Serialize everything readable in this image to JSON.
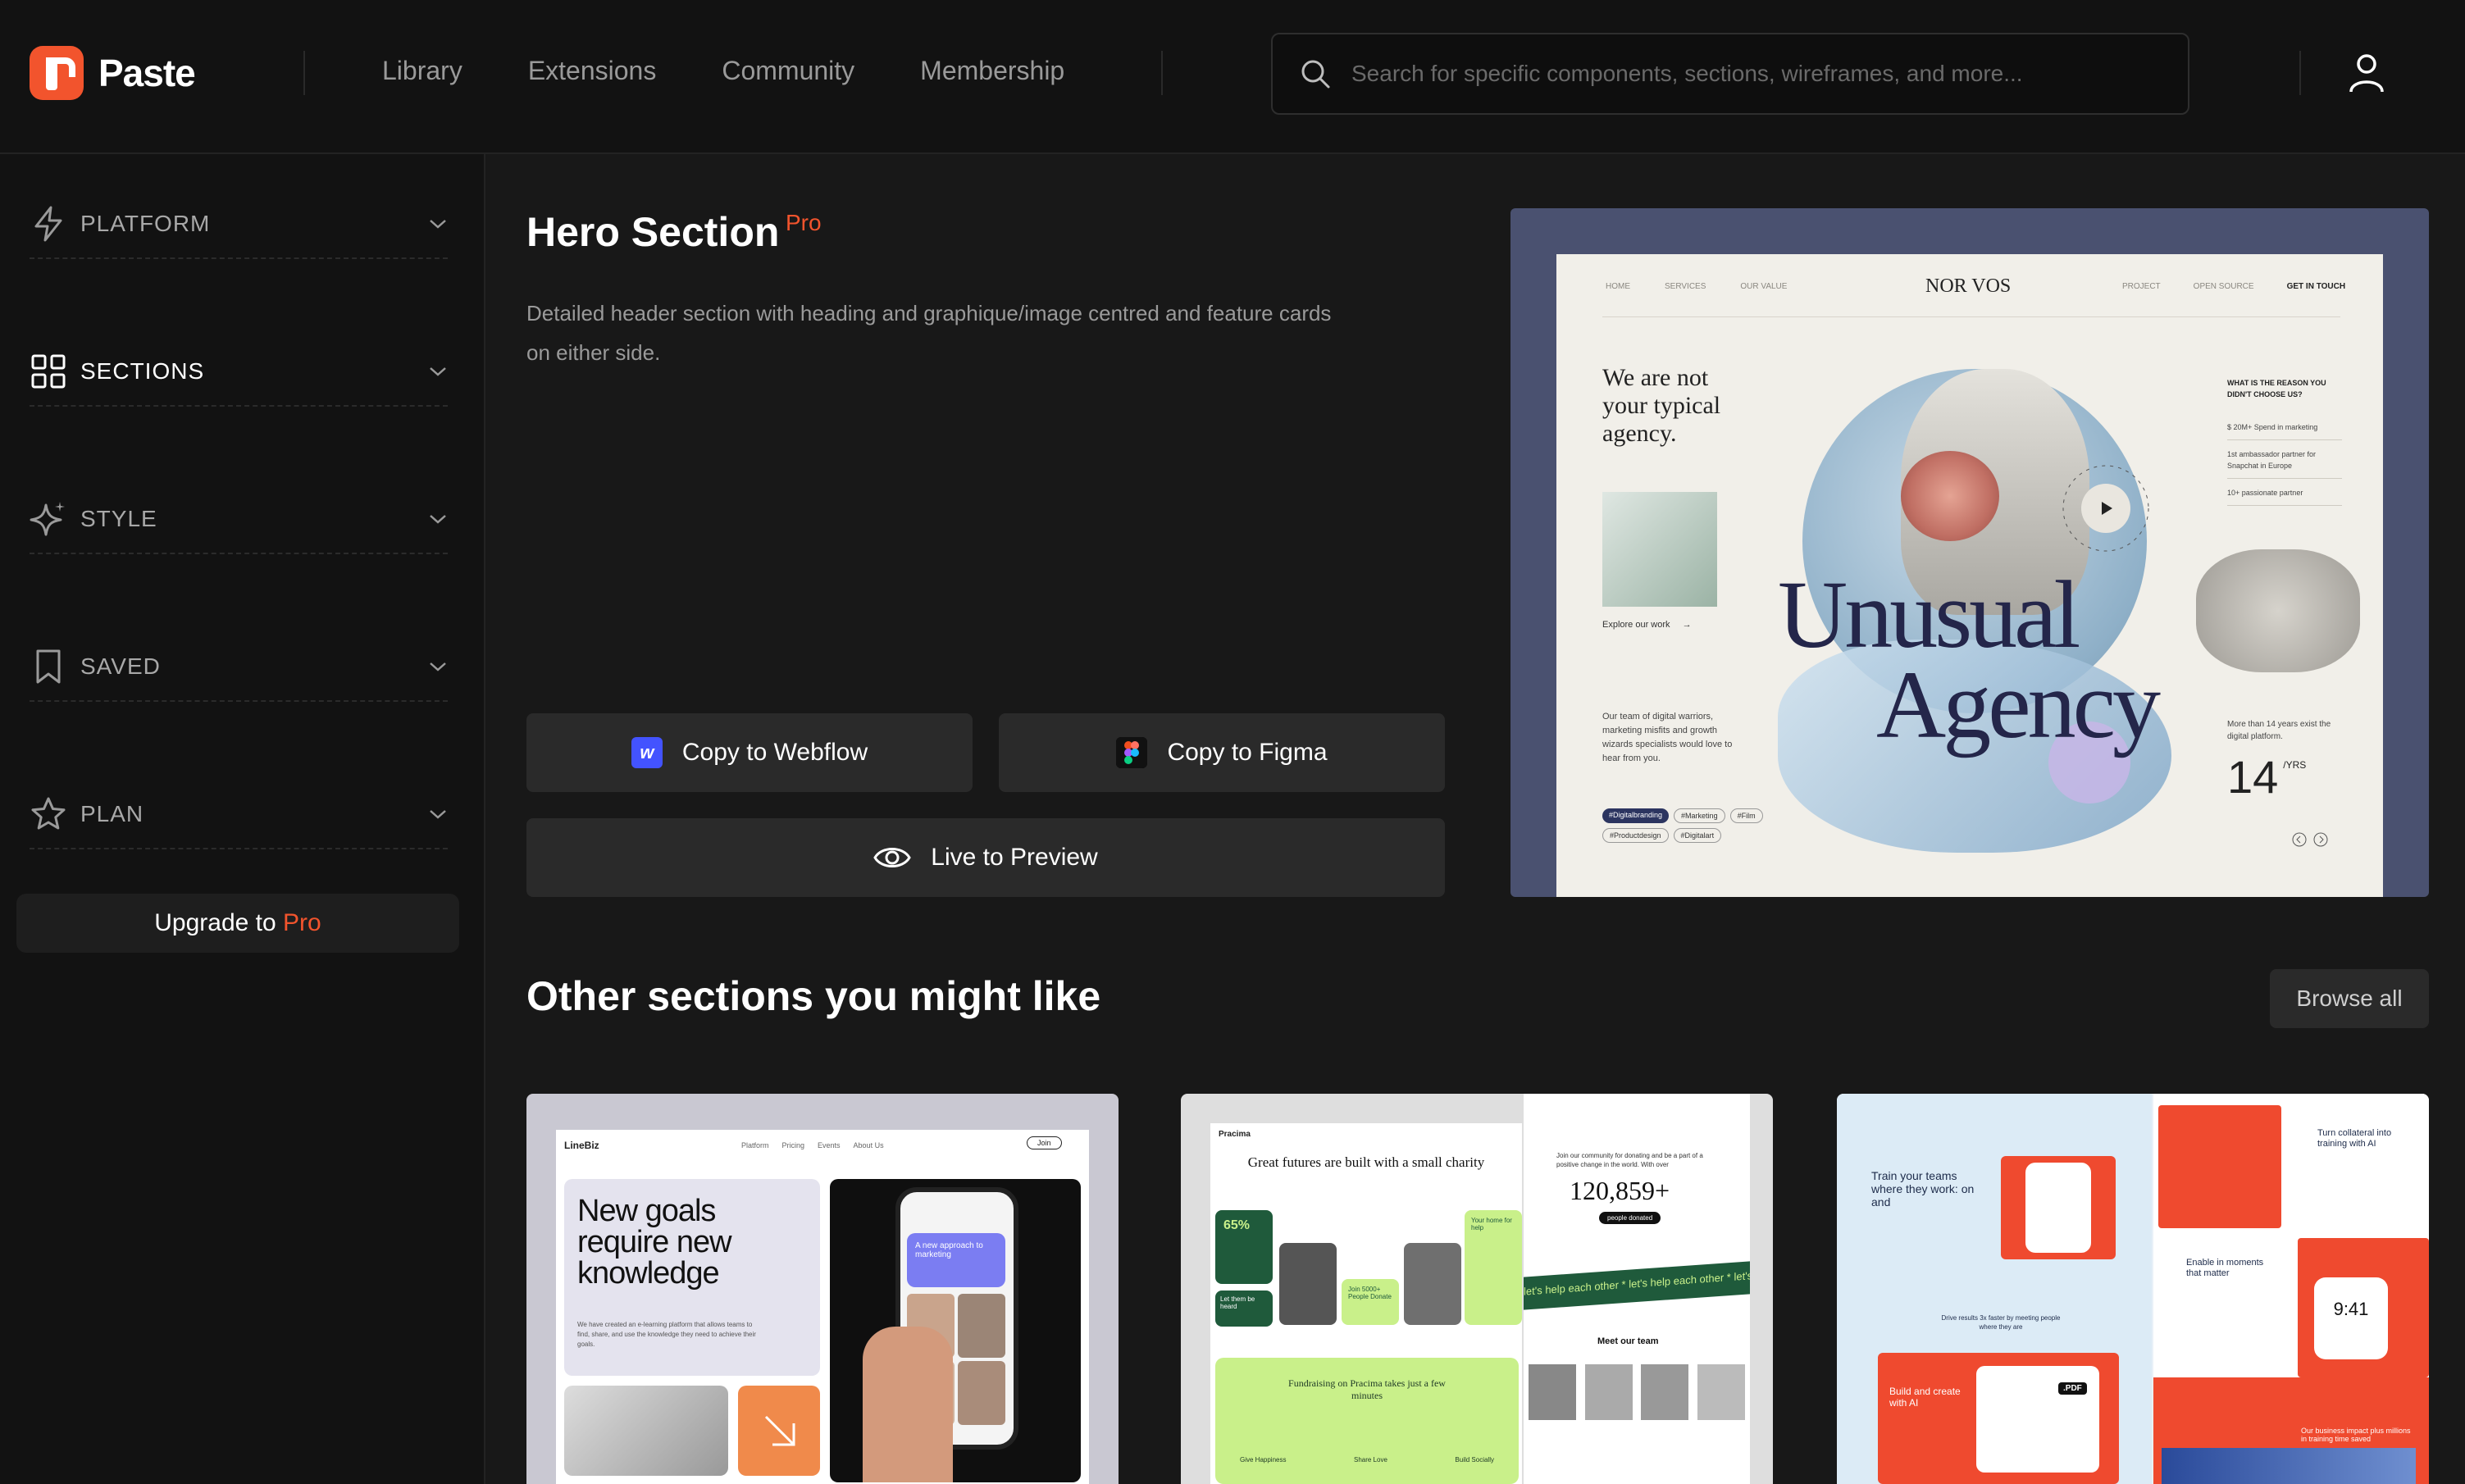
{
  "brand": {
    "name": "Paste",
    "color": "#f2542d"
  },
  "nav": {
    "links": [
      "Library",
      "Extensions",
      "Community",
      "Membership"
    ]
  },
  "search": {
    "placeholder": "Search for specific components, sections, wireframes, and more..."
  },
  "sidebar": {
    "items": [
      {
        "label": "PLATFORM",
        "icon": "lightning-icon"
      },
      {
        "label": "SECTIONS",
        "icon": "grid-icon",
        "active": true
      },
      {
        "label": "STYLE",
        "icon": "sparkle-icon"
      },
      {
        "label": "SAVED",
        "icon": "bookmark-icon"
      },
      {
        "label": "PLAN",
        "icon": "star-icon"
      }
    ],
    "upgrade": {
      "prefix": "Upgrade to",
      "highlight": "Pro"
    }
  },
  "hero": {
    "title": "Hero Section",
    "badge": "Pro",
    "description": "Detailed header section with heading and graphique/image centred and feature cards on either side.",
    "buttons": {
      "webflow": "Copy to Webflow",
      "figma": "Copy to Figma",
      "preview": "Live to Preview"
    }
  },
  "preview": {
    "nav_left": [
      "HOME",
      "SERVICES",
      "OUR VALUE"
    ],
    "logo": "NOR VOS",
    "nav_right": [
      "PROJECT",
      "OPEN SOURCE",
      "GET IN TOUCH"
    ],
    "tagline": "We are not your typical agency.",
    "explore": "Explore our work",
    "big_line1": "Unusual",
    "big_line2": "Agency",
    "team_text": "Our team of digital warriors, marketing misfits and growth wizards specialists would love to hear from you.",
    "tags": [
      "#Digitalbranding",
      "#Marketing",
      "#Film",
      "#Productdesign",
      "#Digitalart"
    ],
    "reason_title": "WHAT IS THE REASON YOU DIDN'T CHOOSE US?",
    "reasons": [
      "$ 20M+ Spend in marketing",
      "1st ambassador partner for Snapchat in Europe",
      "10+ passionate partner"
    ],
    "years_text": "More than 14 years exist the digital platform.",
    "years_num": "14",
    "years_unit": "/YRS",
    "showreel": "SHOWREEL"
  },
  "other": {
    "title": "Other sections you might like",
    "browse": "Browse all",
    "cards": [
      {
        "brand": "LineBiz",
        "nav": [
          "Platform",
          "Pricing",
          "Events",
          "About Us"
        ],
        "join": "Join",
        "headline": "New goals require new knowledge",
        "body": "We have created an e-learning platform that allows teams to find, share, and use the knowledge they need to achieve their goals.",
        "chat": "A new approach to marketing"
      },
      {
        "brand": "Pracima",
        "headline": "Great futures are built with a small charity",
        "stat": "65%",
        "counter": "120,859+",
        "counter_label": "people donated",
        "community": "Join our community for donating and be a part of a positive change in the world. With over",
        "marquee": "let's help each other * let's help each other * let's help each o",
        "team": "Meet our team",
        "fund": "Fundraising on Pracima takes just a few minutes",
        "fund_items": [
          "Give Happiness",
          "Share Love",
          "Build Socially"
        ],
        "mini": [
          "Let them be heard",
          "Join 5000+ People Donate",
          "Your home for help"
        ]
      },
      {
        "headline": "Train your teams where they work: on and",
        "drive": "Drive results 3x faster by meeting people where they are",
        "build": "Build and create with AI",
        "collateral": "Turn collateral into training with AI",
        "moments": "Enable in moments that matter",
        "time": "9:41",
        "pdf": ".PDF",
        "impact": "Our business impact plus millions in training time saved"
      }
    ]
  }
}
